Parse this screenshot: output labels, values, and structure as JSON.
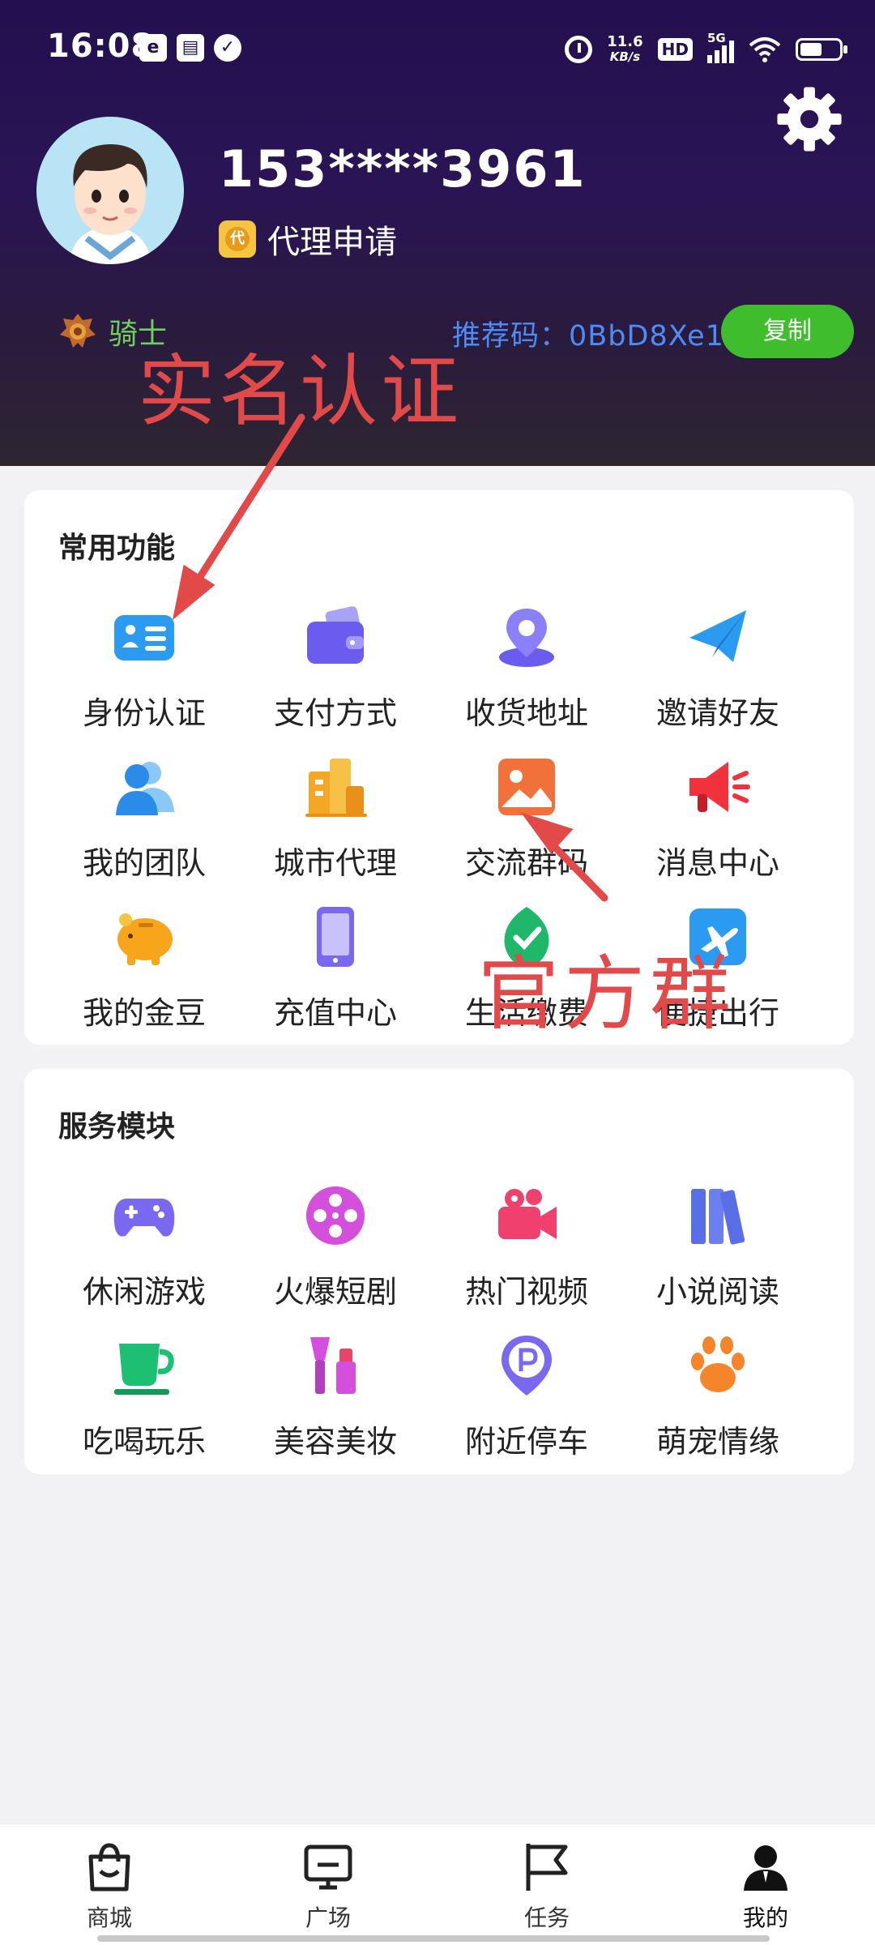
{
  "status_bar": {
    "time": "16:08",
    "net_speed": "11.6",
    "net_unit": "KB/s",
    "hd": "HD",
    "signal": "5G"
  },
  "profile": {
    "phone": "153****3961",
    "agent_badge": "代",
    "agent_label": "代理申请",
    "rank": "骑士",
    "ref_label": "推荐码：0BbD8Xe1",
    "copy_label": "复制"
  },
  "common": {
    "title": "常用功能",
    "items": [
      {
        "label": "身份认证",
        "icon": "id-card-icon"
      },
      {
        "label": "支付方式",
        "icon": "wallet-icon"
      },
      {
        "label": "收货地址",
        "icon": "location-pin-icon"
      },
      {
        "label": "邀请好友",
        "icon": "paper-plane-icon"
      },
      {
        "label": "我的团队",
        "icon": "team-icon"
      },
      {
        "label": "城市代理",
        "icon": "city-icon"
      },
      {
        "label": "交流群码",
        "icon": "qr-image-icon"
      },
      {
        "label": "消息中心",
        "icon": "megaphone-icon"
      },
      {
        "label": "我的金豆",
        "icon": "piggy-bank-icon"
      },
      {
        "label": "充值中心",
        "icon": "phone-recharge-icon"
      },
      {
        "label": "生活缴费",
        "icon": "leaf-check-icon"
      },
      {
        "label": "便捷出行",
        "icon": "airplane-icon"
      }
    ]
  },
  "service": {
    "title": "服务模块",
    "items": [
      {
        "label": "休闲游戏",
        "icon": "gamepad-icon"
      },
      {
        "label": "火爆短剧",
        "icon": "film-reel-icon"
      },
      {
        "label": "热门视频",
        "icon": "video-camera-icon"
      },
      {
        "label": "小说阅读",
        "icon": "books-icon"
      },
      {
        "label": "吃喝玩乐",
        "icon": "cup-icon"
      },
      {
        "label": "美容美妆",
        "icon": "cosmetics-icon"
      },
      {
        "label": "附近停车",
        "icon": "parking-icon"
      },
      {
        "label": "萌宠情缘",
        "icon": "paw-icon"
      }
    ]
  },
  "annotations": {
    "realname": "实名认证",
    "official_group": "官方群"
  },
  "bottom_nav": [
    {
      "label": "商城",
      "icon": "shopping-bag-icon"
    },
    {
      "label": "广场",
      "icon": "monitor-icon"
    },
    {
      "label": "任务",
      "icon": "flag-icon"
    },
    {
      "label": "我的",
      "icon": "user-icon"
    }
  ],
  "colors": {
    "header_top": "#23104f",
    "copy_button": "#3fbd2c",
    "ref_code": "#4d8cf5",
    "annotation": "#e24a4a"
  }
}
